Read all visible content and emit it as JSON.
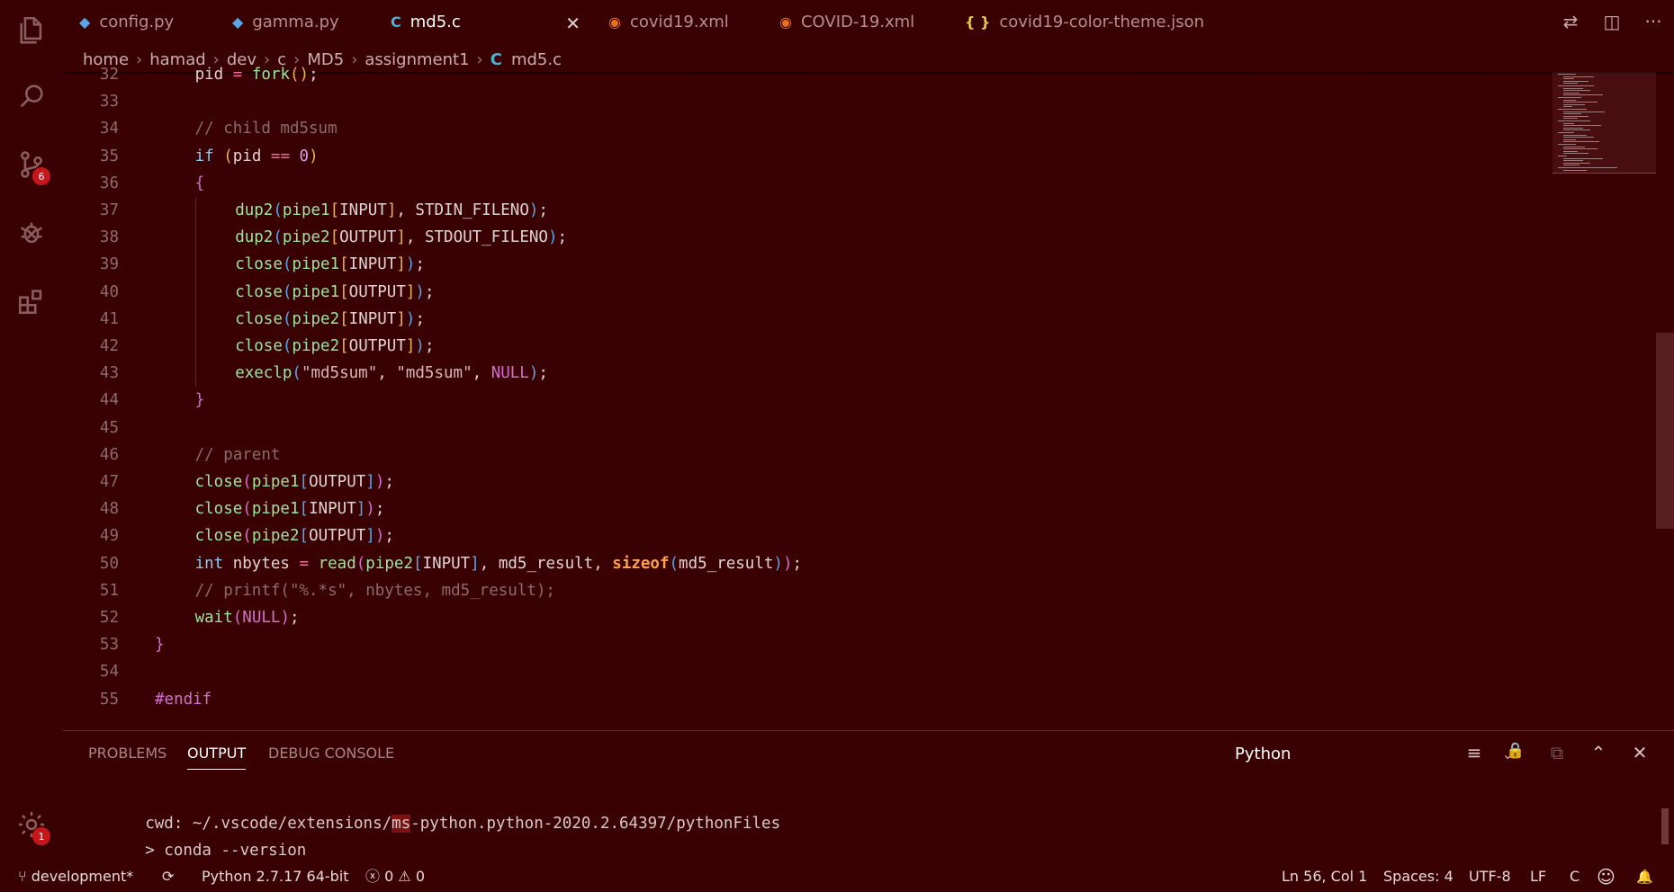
{
  "activity": {
    "scm_badge": "6",
    "settings_badge": "1"
  },
  "tabs": [
    {
      "icon": "python-icon",
      "icon_glyph": "◆",
      "label": "config.py",
      "color": "#5aa4e8"
    },
    {
      "icon": "python-icon",
      "icon_glyph": "◆",
      "label": "gamma.py",
      "color": "#5aa4e8"
    },
    {
      "icon": "c-file-icon",
      "icon_glyph": "C",
      "label": "md5.c",
      "color": "#4fb0d6",
      "active": true
    },
    {
      "icon": "rss-icon",
      "icon_glyph": "◉",
      "label": "covid19.xml",
      "color": "#e8701a"
    },
    {
      "icon": "rss-icon",
      "icon_glyph": "◉",
      "label": "COVID-19.xml",
      "color": "#e8701a"
    },
    {
      "icon": "json-icon",
      "icon_glyph": "{ }",
      "label": "covid19-color-theme.json",
      "color": "#e6c84a"
    }
  ],
  "tab_close_glyph": "✕",
  "tab_actions": {
    "compare": "⇄",
    "split": "◫",
    "more": "···"
  },
  "breadcrumb": [
    "home",
    "hamad",
    "dev",
    "c",
    "MD5",
    "assignment1"
  ],
  "breadcrumb_sep": "›",
  "breadcrumb_file": {
    "icon": "C",
    "label": "md5.c"
  },
  "editor": {
    "lines": [
      {
        "n": "32",
        "indent": 1
      },
      {
        "n": "33",
        "indent": 0
      },
      {
        "n": "34",
        "indent": 1
      },
      {
        "n": "35",
        "indent": 1
      },
      {
        "n": "36",
        "indent": 1
      },
      {
        "n": "37",
        "indent": 2
      },
      {
        "n": "38",
        "indent": 2
      },
      {
        "n": "39",
        "indent": 2
      },
      {
        "n": "40",
        "indent": 2
      },
      {
        "n": "41",
        "indent": 2
      },
      {
        "n": "42",
        "indent": 2
      },
      {
        "n": "43",
        "indent": 2
      },
      {
        "n": "44",
        "indent": 1
      },
      {
        "n": "45",
        "indent": 0
      },
      {
        "n": "46",
        "indent": 1
      },
      {
        "n": "47",
        "indent": 1
      },
      {
        "n": "48",
        "indent": 1
      },
      {
        "n": "49",
        "indent": 1
      },
      {
        "n": "50",
        "indent": 1
      },
      {
        "n": "51",
        "indent": 1
      },
      {
        "n": "52",
        "indent": 1
      },
      {
        "n": "53",
        "indent": 0
      },
      {
        "n": "54",
        "indent": 0
      },
      {
        "n": "55",
        "indent": 0
      }
    ],
    "tokens": [
      [
        [
          "pid ",
          ""
        ],
        [
          "=",
          "op"
        ],
        [
          " ",
          ""
        ],
        [
          "fork",
          "fn"
        ],
        [
          "()",
          "br1"
        ],
        [
          ";",
          ""
        ]
      ],
      [],
      [
        [
          "// child md5sum",
          "cm"
        ]
      ],
      [
        [
          "if",
          "kw"
        ],
        [
          " ",
          ""
        ],
        [
          "(",
          "br1"
        ],
        [
          "pid ",
          ""
        ],
        [
          "==",
          "op"
        ],
        [
          " ",
          ""
        ],
        [
          "0",
          "num"
        ],
        [
          ")",
          "br1"
        ]
      ],
      [
        [
          "{",
          "br2"
        ]
      ],
      [
        [
          "dup2",
          "fn"
        ],
        [
          "(",
          "br3"
        ],
        [
          "pipe1",
          "fn"
        ],
        [
          "[",
          "br1"
        ],
        [
          "INPUT",
          ""
        ],
        [
          "]",
          "br1"
        ],
        [
          ", STDIN_FILENO",
          ""
        ],
        [
          ")",
          "br3"
        ],
        [
          ";",
          ""
        ]
      ],
      [
        [
          "dup2",
          "fn"
        ],
        [
          "(",
          "br3"
        ],
        [
          "pipe2",
          "fn"
        ],
        [
          "[",
          "br1"
        ],
        [
          "OUTPUT",
          ""
        ],
        [
          "]",
          "br1"
        ],
        [
          ", STDOUT_FILENO",
          ""
        ],
        [
          ")",
          "br3"
        ],
        [
          ";",
          ""
        ]
      ],
      [
        [
          "close",
          "fn"
        ],
        [
          "(",
          "br3"
        ],
        [
          "pipe1",
          "fn"
        ],
        [
          "[",
          "br1"
        ],
        [
          "INPUT",
          ""
        ],
        [
          "]",
          "br1"
        ],
        [
          ")",
          "br3"
        ],
        [
          ";",
          ""
        ]
      ],
      [
        [
          "close",
          "fn"
        ],
        [
          "(",
          "br3"
        ],
        [
          "pipe1",
          "fn"
        ],
        [
          "[",
          "br1"
        ],
        [
          "OUTPUT",
          ""
        ],
        [
          "]",
          "br1"
        ],
        [
          ")",
          "br3"
        ],
        [
          ";",
          ""
        ]
      ],
      [
        [
          "close",
          "fn"
        ],
        [
          "(",
          "br3"
        ],
        [
          "pipe2",
          "fn"
        ],
        [
          "[",
          "br1"
        ],
        [
          "INPUT",
          ""
        ],
        [
          "]",
          "br1"
        ],
        [
          ")",
          "br3"
        ],
        [
          ";",
          ""
        ]
      ],
      [
        [
          "close",
          "fn"
        ],
        [
          "(",
          "br3"
        ],
        [
          "pipe2",
          "fn"
        ],
        [
          "[",
          "br1"
        ],
        [
          "OUTPUT",
          ""
        ],
        [
          "]",
          "br1"
        ],
        [
          ")",
          "br3"
        ],
        [
          ";",
          ""
        ]
      ],
      [
        [
          "execlp",
          "fn"
        ],
        [
          "(",
          "br3"
        ],
        [
          "\"md5sum\"",
          "str"
        ],
        [
          ", ",
          ""
        ],
        [
          "\"md5sum\"",
          "str"
        ],
        [
          ", ",
          ""
        ],
        [
          "NULL",
          "mac"
        ],
        [
          ")",
          "br3"
        ],
        [
          ";",
          ""
        ]
      ],
      [
        [
          "}",
          "br2"
        ]
      ],
      [],
      [
        [
          "// parent",
          "cm"
        ]
      ],
      [
        [
          "close",
          "fn"
        ],
        [
          "(",
          "br2"
        ],
        [
          "pipe1",
          "fn"
        ],
        [
          "[",
          "br3"
        ],
        [
          "OUTPUT",
          ""
        ],
        [
          "]",
          "br3"
        ],
        [
          ")",
          "br2"
        ],
        [
          ";",
          ""
        ]
      ],
      [
        [
          "close",
          "fn"
        ],
        [
          "(",
          "br2"
        ],
        [
          "pipe1",
          "fn"
        ],
        [
          "[",
          "br3"
        ],
        [
          "INPUT",
          ""
        ],
        [
          "]",
          "br3"
        ],
        [
          ")",
          "br2"
        ],
        [
          ";",
          ""
        ]
      ],
      [
        [
          "close",
          "fn"
        ],
        [
          "(",
          "br2"
        ],
        [
          "pipe2",
          "fn"
        ],
        [
          "[",
          "br3"
        ],
        [
          "OUTPUT",
          ""
        ],
        [
          "]",
          "br3"
        ],
        [
          ")",
          "br2"
        ],
        [
          ";",
          ""
        ]
      ],
      [
        [
          "int",
          "kw"
        ],
        [
          " nbytes ",
          ""
        ],
        [
          "=",
          "op"
        ],
        [
          " ",
          ""
        ],
        [
          "read",
          "fn"
        ],
        [
          "(",
          "br2"
        ],
        [
          "pipe2",
          "fn"
        ],
        [
          "[",
          "br3"
        ],
        [
          "INPUT",
          ""
        ],
        [
          "]",
          "br3"
        ],
        [
          ", md5_result, ",
          ""
        ],
        [
          "sizeof",
          "sz"
        ],
        [
          "(",
          "br3"
        ],
        [
          "md5_result",
          ""
        ],
        [
          ")",
          "br3"
        ],
        [
          ")",
          "br2"
        ],
        [
          ";",
          ""
        ]
      ],
      [
        [
          "// printf(\"%.*s\", nbytes, md5_result);",
          "cm"
        ]
      ],
      [
        [
          "wait",
          "fn"
        ],
        [
          "(",
          "br2"
        ],
        [
          "NULL",
          "mac"
        ],
        [
          ")",
          "br2"
        ],
        [
          ";",
          ""
        ]
      ],
      [
        [
          "}",
          "br2"
        ]
      ],
      [],
      [
        [
          "#endif",
          "mac"
        ]
      ]
    ]
  },
  "panel": {
    "tabs": [
      {
        "label": "PROBLEMS"
      },
      {
        "label": "OUTPUT",
        "active": true
      },
      {
        "label": "DEBUG CONSOLE"
      }
    ],
    "channel": "Python",
    "actions": {
      "clear": "≡",
      "lock": "🔒",
      "copy": "⧉",
      "maximize": "⌃",
      "close": "✕"
    },
    "output_lines": [
      {
        "before": "cwd: ~/.vscode/extensions/",
        "highlight": "ms",
        "after": "-python.python-2020.2.64397/pythonFiles"
      },
      {
        "before": "> conda --version",
        "highlight": "",
        "after": ""
      }
    ]
  },
  "status": {
    "branch": "development*",
    "sync_glyph": "⟳",
    "interpreter": "Python 2.7.17 64-bit",
    "errors": "0",
    "warnings": "0",
    "error_glyph": "ⓧ",
    "warning_glyph": "⚠",
    "position": "Ln 56, Col 1",
    "spaces": "Spaces: 4",
    "encoding": "UTF-8",
    "eol": "LF",
    "language": "C",
    "feedback_glyph": "☺",
    "bell_glyph": "🔔"
  },
  "colors": {
    "background": "#3a0102",
    "badge": "#c8161d",
    "keyword": "#8fc9ef",
    "function": "#9ee49c",
    "operator": "#f26a9a",
    "comment": "#8a6b6c"
  }
}
